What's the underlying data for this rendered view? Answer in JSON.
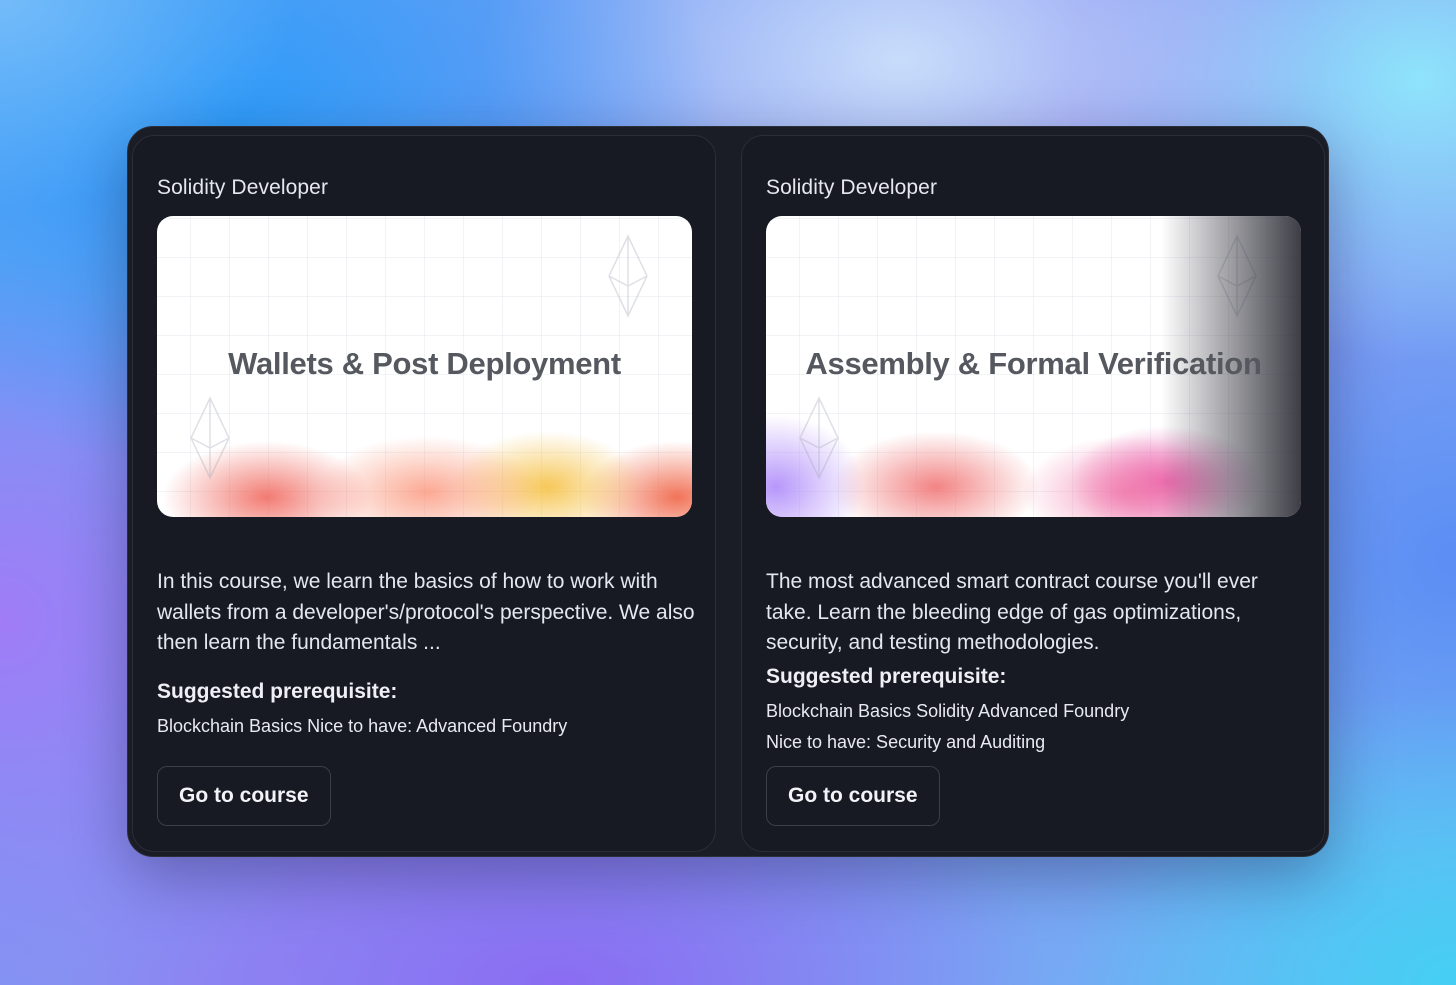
{
  "cards": [
    {
      "eyebrow": "Solidity Developer",
      "thumbnail_title": "Wallets & Post Deployment",
      "description": "In this course, we learn the basics of how to work with wallets from a developer's/protocol's perspective. We also then learn the fundamentals ...",
      "prereq_heading": "Suggested prerequisite:",
      "prereq_lines": [
        "Blockchain Basics Nice to have: Advanced Foundry"
      ],
      "button_label": "Go to course"
    },
    {
      "eyebrow": "Solidity Developer",
      "thumbnail_title": "Assembly & Formal Verification",
      "description": "The most advanced smart contract course you'll ever take. Learn the bleeding edge of gas optimizations, security, and testing methodologies.",
      "prereq_heading": "Suggested prerequisite:",
      "prereq_lines": [
        "Blockchain Basics Solidity Advanced Foundry",
        "Nice to have: Security and Auditing"
      ],
      "button_label": "Go to course"
    }
  ],
  "icons": {
    "thumbnail_decoration": "ethereum-diamond-icon"
  },
  "colors": {
    "card_bg": "#171a23",
    "frame_bg": "#1a1d26",
    "button_border": "#3a3e4a"
  }
}
